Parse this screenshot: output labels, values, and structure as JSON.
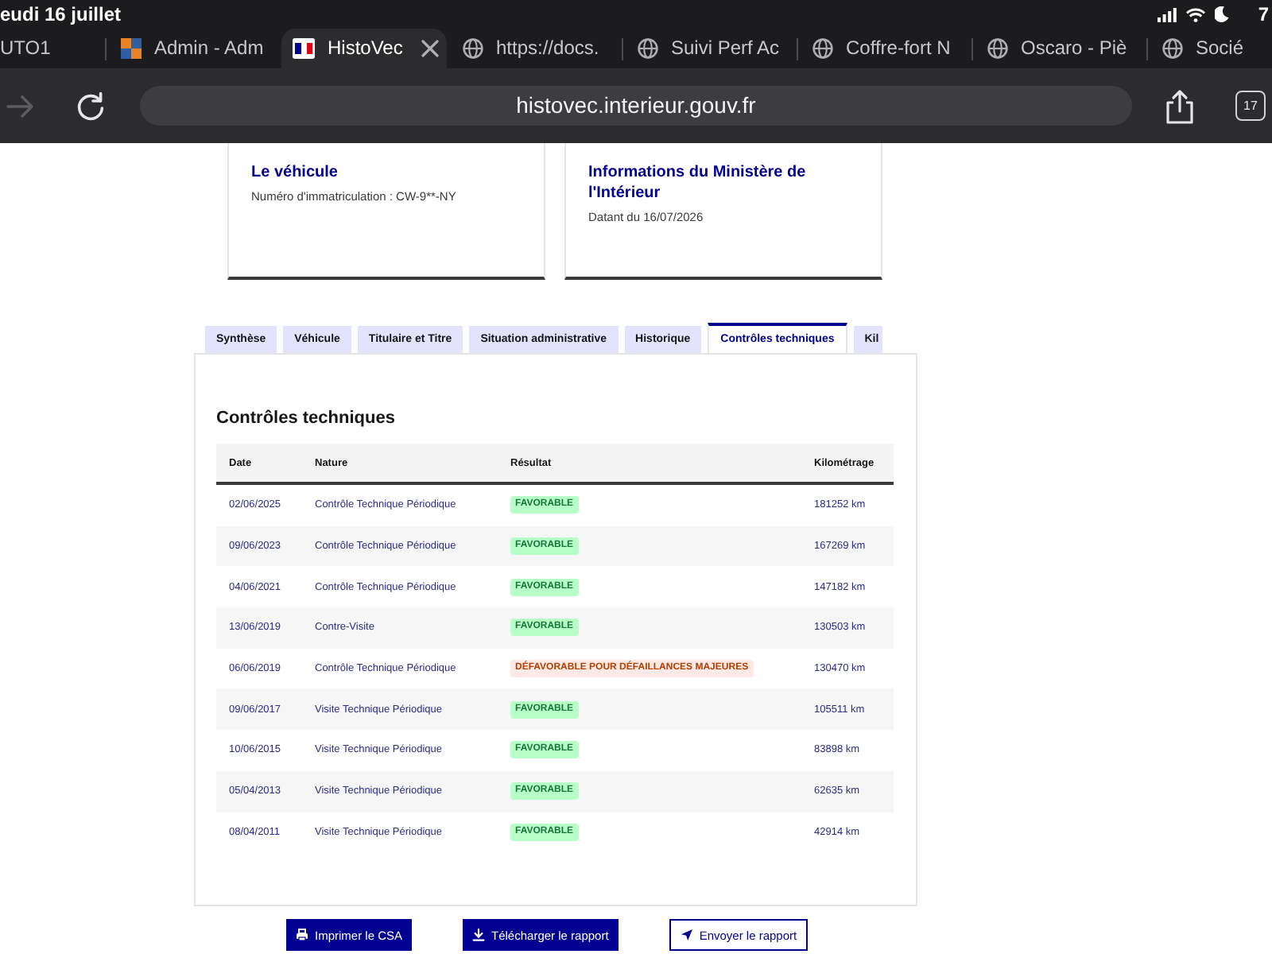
{
  "status_bar": {
    "date": "eudi 16 juillet",
    "battery": "7"
  },
  "browser_tabs": [
    {
      "title": "UTO1",
      "kind": "bare",
      "selected": false
    },
    {
      "title": "Admin - Adm",
      "kind": "app",
      "selected": false
    },
    {
      "title": "HistoVec",
      "kind": "gov",
      "selected": true
    },
    {
      "title": "https://docs.",
      "kind": "web",
      "selected": false
    },
    {
      "title": "Suivi Perf Ac",
      "kind": "web",
      "selected": false
    },
    {
      "title": "Coffre-fort N",
      "kind": "web",
      "selected": false
    },
    {
      "title": "Oscaro - Piè",
      "kind": "web",
      "selected": false
    },
    {
      "title": "Socié",
      "kind": "web",
      "selected": false
    }
  ],
  "toolbar": {
    "forward_disabled": true,
    "url": "histovec.interieur.gouv.fr",
    "tab_count": "17"
  },
  "cards": [
    {
      "title": "Le véhicule",
      "text": "Numéro d'immatriculation : CW-9**-NY"
    },
    {
      "title": "Informations du Ministère de l'Intérieur",
      "text": "Datant du 16/07/2026"
    }
  ],
  "tabs": [
    {
      "label": "Synthèse",
      "selected": false
    },
    {
      "label": "Véhicule",
      "selected": false
    },
    {
      "label": "Titulaire et Titre",
      "selected": false
    },
    {
      "label": "Situation administrative",
      "selected": false
    },
    {
      "label": "Historique",
      "selected": false
    },
    {
      "label": "Contrôles techniques",
      "selected": true
    },
    {
      "label": "Kil",
      "selected": false
    }
  ],
  "panel": {
    "heading": "Contrôles techniques",
    "table": {
      "columns": [
        "Date",
        "Nature",
        "Résultat",
        "Kilométrage"
      ],
      "rows": [
        {
          "date": "02/06/2025",
          "nature": "Contrôle Technique Périodique",
          "result": {
            "text": "FAVORABLE",
            "kind": "success"
          },
          "mileage": "181252 km"
        },
        {
          "date": "09/06/2023",
          "nature": "Contrôle Technique Périodique",
          "result": {
            "text": "FAVORABLE",
            "kind": "success"
          },
          "mileage": "167269 km"
        },
        {
          "date": "04/06/2021",
          "nature": "Contrôle Technique Périodique",
          "result": {
            "text": "FAVORABLE",
            "kind": "success"
          },
          "mileage": "147182 km"
        },
        {
          "date": "13/06/2019",
          "nature": "Contre-Visite",
          "result": {
            "text": "FAVORABLE",
            "kind": "success"
          },
          "mileage": "130503 km"
        },
        {
          "date": "06/06/2019",
          "nature": "Contrôle Technique Périodique",
          "result": {
            "text": "DÉFAVORABLE POUR DÉFAILLANCES MAJEURES",
            "kind": "error"
          },
          "mileage": "130470 km"
        },
        {
          "date": "09/06/2017",
          "nature": "Visite Technique Périodique",
          "result": {
            "text": "FAVORABLE",
            "kind": "success"
          },
          "mileage": "105511 km"
        },
        {
          "date": "10/06/2015",
          "nature": "Visite Technique Périodique",
          "result": {
            "text": "FAVORABLE",
            "kind": "success"
          },
          "mileage": "83898 km"
        },
        {
          "date": "05/04/2013",
          "nature": "Visite Technique Périodique",
          "result": {
            "text": "FAVORABLE",
            "kind": "success"
          },
          "mileage": "62635 km"
        },
        {
          "date": "08/04/2011",
          "nature": "Visite Technique Périodique",
          "result": {
            "text": "FAVORABLE",
            "kind": "success"
          },
          "mileage": "42914 km"
        }
      ]
    }
  },
  "actions": [
    {
      "label": "Imprimer le CSA",
      "kind": "print"
    },
    {
      "label": "Télécharger le rapport",
      "kind": "download"
    },
    {
      "label": "Envoyer le rapport",
      "kind": "send"
    }
  ]
}
